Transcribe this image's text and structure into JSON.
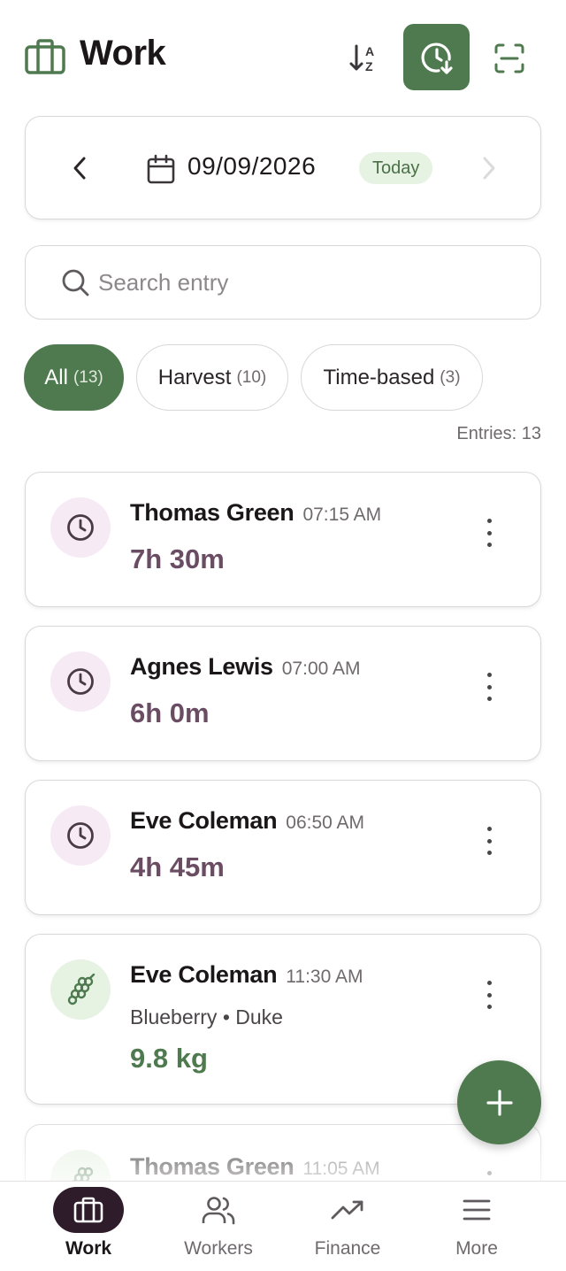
{
  "header": {
    "title": "Work",
    "icons": {
      "brand": "briefcase-icon",
      "sort": "sort-a-z-icon",
      "history": "clock-download-icon",
      "scan": "scan-icon"
    }
  },
  "date_nav": {
    "date": "09/09/2026",
    "badge": "Today"
  },
  "search": {
    "placeholder": "Search entry",
    "value": ""
  },
  "filters": [
    {
      "label": "All",
      "count": "(13)",
      "selected": true
    },
    {
      "label": "Harvest",
      "count": "(10)",
      "selected": false
    },
    {
      "label": "Time-based",
      "count": "(3)",
      "selected": false
    }
  ],
  "entries_count": "Entries: 13",
  "entries": [
    {
      "type": "time",
      "name": "Thomas Green",
      "time": "07:15 AM",
      "duration": "7h 30m"
    },
    {
      "type": "time",
      "name": "Agnes Lewis",
      "time": "07:00 AM",
      "duration": "6h 0m"
    },
    {
      "type": "time",
      "name": "Eve Coleman",
      "time": "06:50 AM",
      "duration": "4h 45m"
    },
    {
      "type": "harvest",
      "name": "Eve Coleman",
      "time": "11:30 AM",
      "details": "Blueberry • Duke",
      "amount": "9.8 kg"
    },
    {
      "type": "harvest",
      "name": "Thomas Green",
      "time": "11:05 AM"
    }
  ],
  "bottom_nav": [
    {
      "label": "Work",
      "icon": "briefcase-icon",
      "active": true
    },
    {
      "label": "Workers",
      "icon": "users-icon",
      "active": false
    },
    {
      "label": "Finance",
      "icon": "trending-up-icon",
      "active": false
    },
    {
      "label": "More",
      "icon": "menu-icon",
      "active": false
    }
  ],
  "colors": {
    "primary": "#4f7a4f",
    "duration": "#6a4d63",
    "nav_active_bg": "#2e1c2b",
    "today_badge_bg": "#e6f2e2"
  }
}
